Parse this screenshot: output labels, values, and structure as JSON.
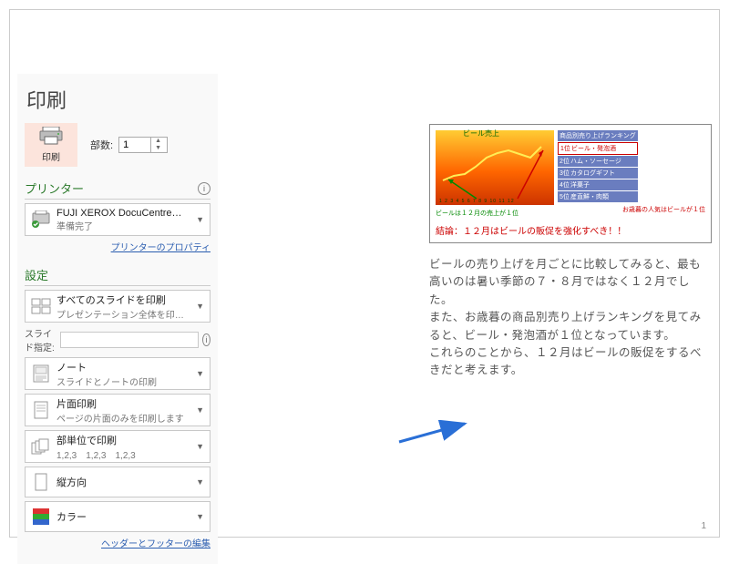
{
  "title": "印刷",
  "print_button_label": "印刷",
  "copies": {
    "label": "部数:",
    "value": "1"
  },
  "printer": {
    "heading": "プリンター",
    "name": "FUJI XEROX DocuCentre…",
    "status": "準備完了",
    "properties_link": "プリンターのプロパティ"
  },
  "settings": {
    "heading": "設定",
    "range": {
      "line1": "すべてのスライドを印刷",
      "line2": "プレゼンテーション全体を印刷し…"
    },
    "slide_spec": {
      "label": "スライド指定:",
      "value": ""
    },
    "layout": {
      "line1": "ノート",
      "line2": "スライドとノートの印刷"
    },
    "sides": {
      "line1": "片面印刷",
      "line2": "ページの片面のみを印刷します"
    },
    "collate": {
      "line1": "部単位で印刷",
      "line2": "1,2,3　1,2,3　1,2,3"
    },
    "orient": {
      "line1": "縦方向"
    },
    "color": {
      "line1": "カラー"
    },
    "footer_link": "ヘッダーとフッターの編集"
  },
  "preview": {
    "chart_title": "ビール売上",
    "rank_head": "商品別売り上げランキング",
    "ranks": [
      {
        "n": "1位",
        "t": "ビール・発泡酒",
        "hl": true
      },
      {
        "n": "2位",
        "t": "ハム・ソーセージ"
      },
      {
        "n": "3位",
        "t": "カタログギフト"
      },
      {
        "n": "4位",
        "t": "洋菓子"
      },
      {
        "n": "5位",
        "t": "産直鮮・肉類"
      }
    ],
    "note_green": "ビールは１２月の売上が１位",
    "note_red": "お歳暮の人気はビールが１位",
    "conclusion": "結論：１２月はビールの販促を強化すべき！！",
    "body": "ビールの売り上げを月ごとに比較してみると、最も高いのは暑い季節の７・８月ではなく１２月でした。\nまた、お歳暮の商品別売り上げランキングを見てみると、ビール・発泡酒が１位となっています。\nこれらのことから、１２月はビールの販促をするべきだと考えます。"
  },
  "page_number": "1"
}
